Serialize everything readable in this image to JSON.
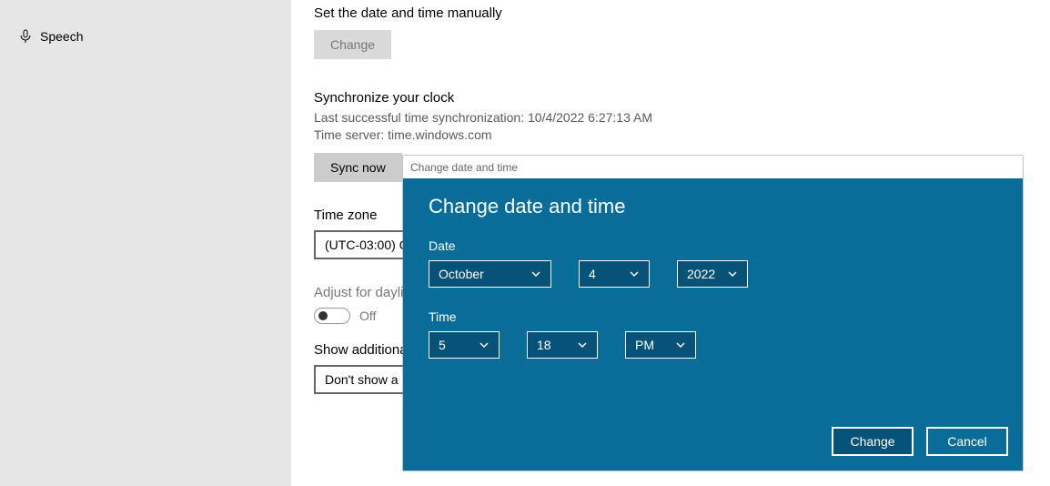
{
  "sidebar": {
    "speech_label": "Speech"
  },
  "main": {
    "set_manual_title": "Set the date and time manually",
    "change_btn": "Change",
    "sync_title": "Synchronize your clock",
    "last_sync_line": "Last successful time synchronization: 10/4/2022 6:27:13 AM",
    "time_server_line": "Time server: time.windows.com",
    "sync_now_btn": "Sync now",
    "timezone_label": "Time zone",
    "timezone_value": "(UTC-03:00) C",
    "daylight_label": "Adjust for dayli",
    "toggle_state": "Off",
    "additional_label": "Show additiona",
    "additional_value": "Don't show a"
  },
  "dialog": {
    "title": "Change date and time",
    "heading": "Change date and time",
    "date_label": "Date",
    "month": "October",
    "day": "4",
    "year": "2022",
    "time_label": "Time",
    "hour": "5",
    "minute": "18",
    "ampm": "PM",
    "change_btn": "Change",
    "cancel_btn": "Cancel"
  }
}
